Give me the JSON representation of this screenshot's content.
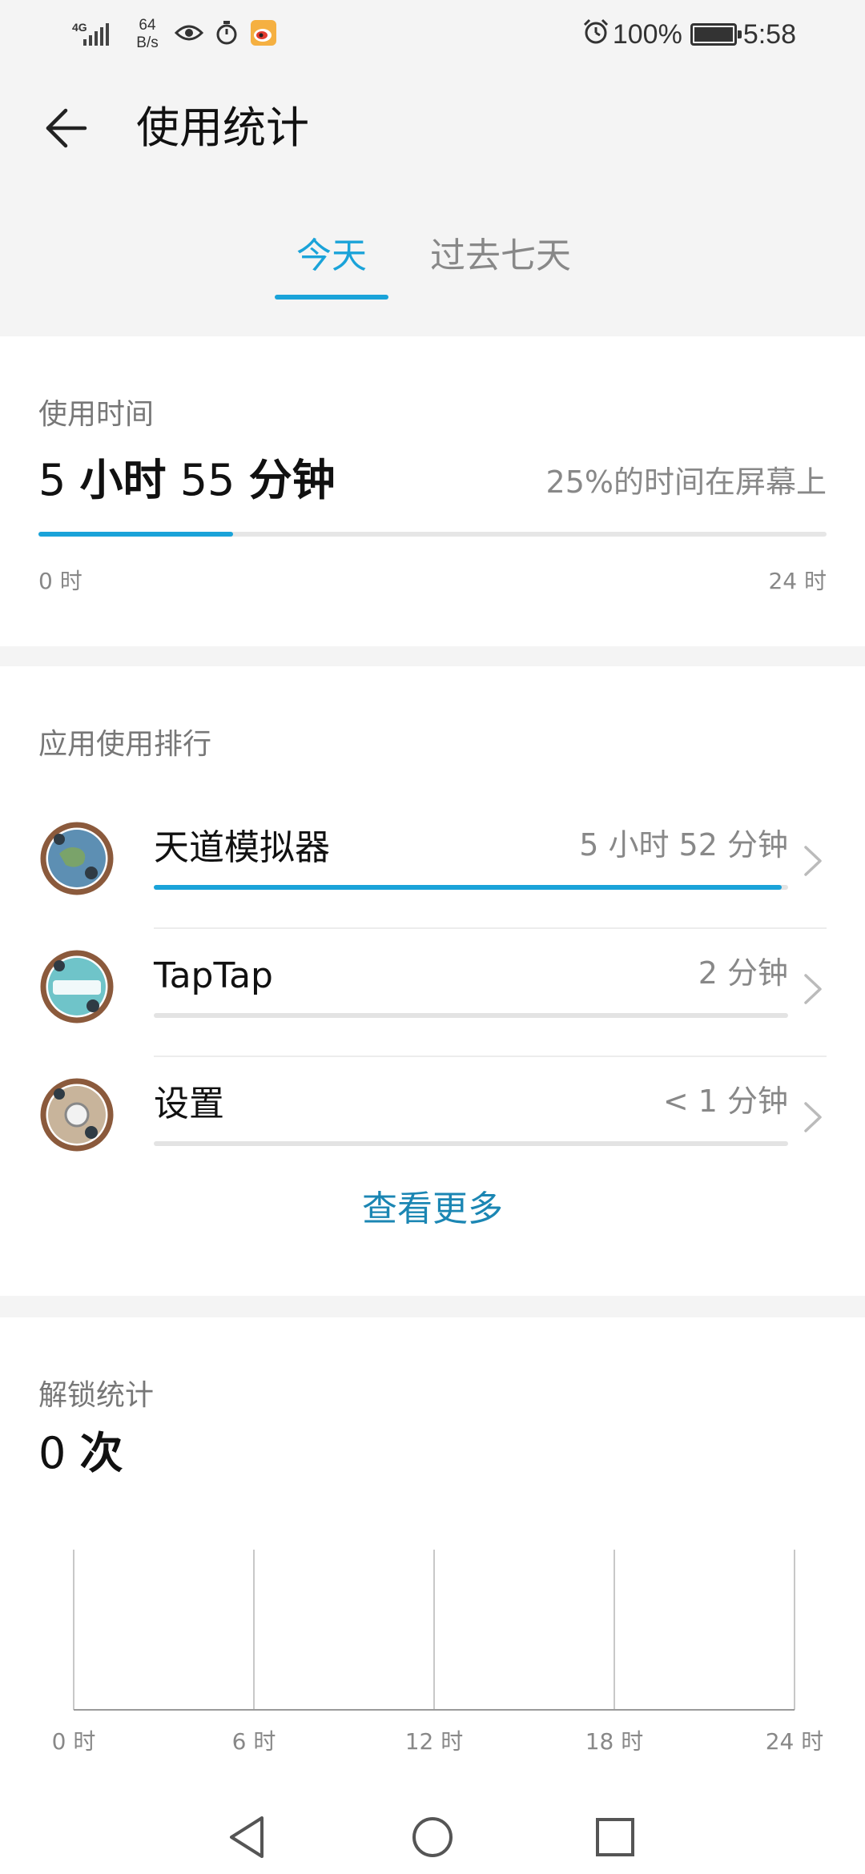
{
  "status_bar": {
    "network": "4G",
    "speed_value": "64",
    "speed_unit": "B/s",
    "battery_percent": "100%",
    "time": "5:58"
  },
  "header": {
    "title": "使用统计"
  },
  "tabs": [
    {
      "label": "今天",
      "active": true
    },
    {
      "label": "过去七天",
      "active": false
    }
  ],
  "usage": {
    "label": "使用时间",
    "hours": "5",
    "hours_unit": "小时",
    "minutes": "55",
    "minutes_unit": "分钟",
    "screen_ratio": "25%的时间在屏幕上",
    "fraction_of_day": 0.247,
    "axis_min": "0 时",
    "axis_max": "24 时"
  },
  "ranking": {
    "label": "应用使用排行",
    "apps": [
      {
        "name": "天道模拟器",
        "time": "5 小时 52 分钟",
        "fraction": 0.99
      },
      {
        "name": "TapTap",
        "time": "2 分钟",
        "fraction": 0.0
      },
      {
        "name": "设置",
        "time": "< 1 分钟",
        "fraction": 0.0
      }
    ],
    "see_more": "查看更多"
  },
  "unlock": {
    "label": "解锁统计",
    "count": "0",
    "count_unit": "次"
  },
  "chart_data": {
    "type": "bar",
    "title": "",
    "xlabel": "",
    "ylabel": "",
    "x_ticks": [
      "0 时",
      "6 时",
      "12 时",
      "18 时",
      "24 时"
    ],
    "xlim": [
      0,
      24
    ],
    "values": [],
    "grid": true
  },
  "colors": {
    "accent": "#1aa3d9",
    "link": "#1b86b3",
    "background": "#f4f4f4"
  }
}
